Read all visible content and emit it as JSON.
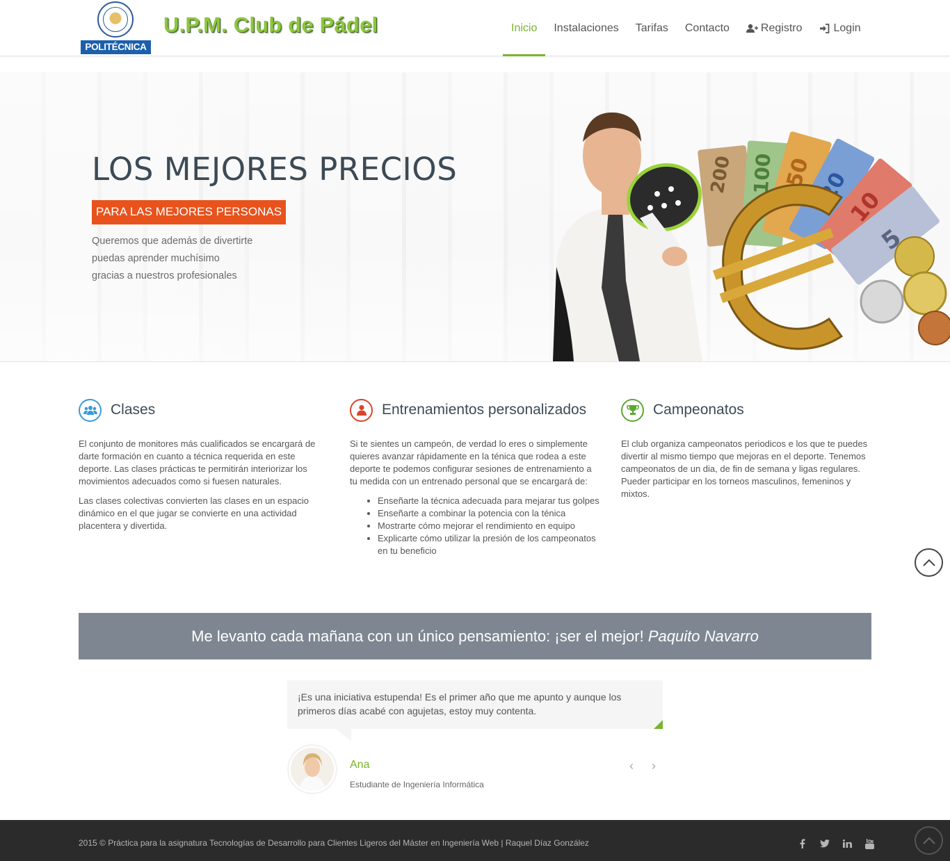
{
  "header": {
    "logo_text": "POLITÉCNICA",
    "brand": "U.P.M. Club de Pádel",
    "nav": [
      {
        "label": "Inicio",
        "active": true
      },
      {
        "label": "Instalaciones"
      },
      {
        "label": "Tarifas"
      },
      {
        "label": "Contacto"
      },
      {
        "label": "Registro",
        "icon": "user-plus-icon"
      },
      {
        "label": "Login",
        "icon": "sign-in-icon"
      }
    ]
  },
  "hero": {
    "title": "LOS MEJORES PRECIOS",
    "tag": "PARA LAS MEJORES PERSONAS",
    "lines": [
      "Queremos que además de divertirte",
      "puedas aprender muchísimo",
      "gracias a nuestros profesionales"
    ],
    "banknotes": [
      "200",
      "100",
      "50",
      "20",
      "10",
      "5"
    ]
  },
  "features": [
    {
      "title": "Clases",
      "icon": "users-icon",
      "color": "#3a9ad9",
      "paragraphs": [
        "El conjunto de monitores más cualificados se encargará de darte formación en cuanto a técnica requerida en este deporte. Las clases prácticas te permitirán interiorizar los movimientos adecuados como si fuesen naturales.",
        "Las clases colectivas convierten las clases en un espacio dinámico en el que jugar se convierte en una actividad placentera y divertida."
      ]
    },
    {
      "title": "Entrenamientos personalizados",
      "icon": "user-icon",
      "color": "#d9442a",
      "paragraphs": [
        "Si te sientes un campeón, de verdad lo eres o simplemente quieres avanzar rápidamente en la ténica que rodea a este deporte te podemos configurar sesiones de entrenamiento a tu medida con un entrenado personal que se encargará de:"
      ],
      "list": [
        "Enseñarte la técnica adecuada para mejarar tus golpes",
        "Enseñarte a combinar la potencia con la ténica",
        "Mostrarte cómo mejorar el rendimiento en equipo",
        "Explicarte cómo utilizar la presión de los campeonatos en tu beneficio"
      ]
    },
    {
      "title": "Campeonatos",
      "icon": "trophy-icon",
      "color": "#5aa832",
      "paragraphs": [
        "El club organiza campeonatos periodicos e los que te puedes divertir al mismo tiempo que mejoras en el deporte. Tenemos campeonatos de un dia, de fin de semana y ligas regulares. Pueder participar en los torneos masculinos, femeninos y mixtos."
      ]
    }
  ],
  "quote": {
    "text": "Me levanto cada mañana con un único pensamiento: ¡ser el mejor!",
    "author": "Paquito Navarro"
  },
  "testimonial": {
    "text": "¡Es una iniciativa estupenda! Es el primer año que me apunto y aunque los primeros días acabé con agujetas, estoy muy contenta.",
    "name": "Ana",
    "role": "Estudiante de Ingeniería Informática",
    "prev": "‹",
    "next": "›"
  },
  "footer": {
    "copyright": "2015 © Práctica para la asignatura Tecnologías de Desarrollo para Clientes Ligeros del Máster en Ingeniería Web | Raquel Díaz González",
    "social": [
      "facebook-icon",
      "twitter-icon",
      "linkedin-icon",
      "youtube-icon"
    ]
  },
  "colors": {
    "accent": "#79b52d",
    "tag": "#e8531d",
    "quote_bg": "#7e8791",
    "footer_bg": "#2b2b2b"
  }
}
